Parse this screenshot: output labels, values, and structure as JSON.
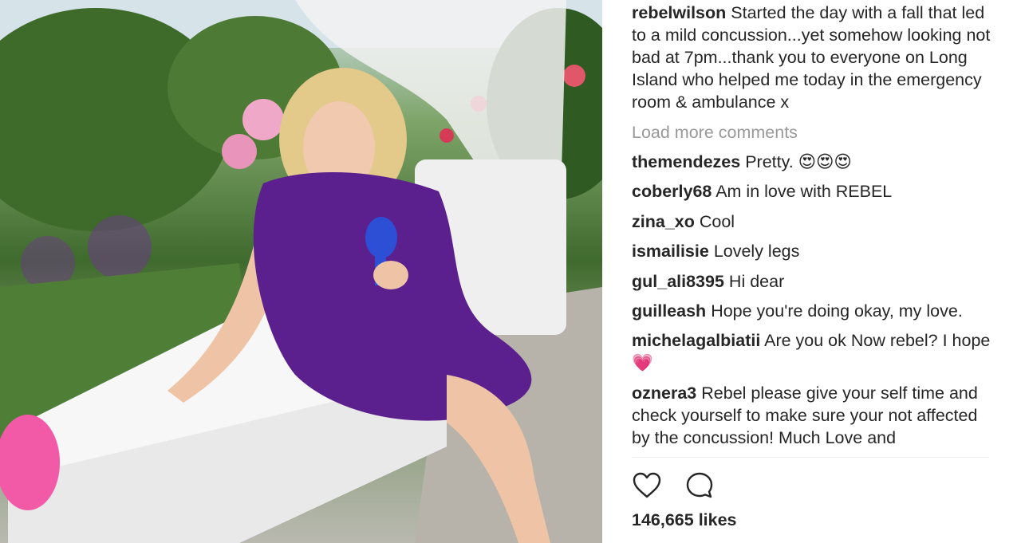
{
  "post": {
    "author": "rebelwilson",
    "caption": "Started the day with a fall that led to a mild concussion...yet somehow looking not bad at 7pm...thank you to everyone on Long Island who helped me today in the emergency room & ambulance x"
  },
  "load_more_label": "Load more comments",
  "comments": [
    {
      "user": "themendezes",
      "text": "Pretty. 😍😍😍"
    },
    {
      "user": "coberly68",
      "text": "Am in love with REBEL"
    },
    {
      "user": "zina_xo",
      "text": "Cool"
    },
    {
      "user": "ismailisie",
      "text": "Lovely legs"
    },
    {
      "user": "gul_ali8395",
      "text": "Hi dear"
    },
    {
      "user": "guilleash",
      "text": "Hope you're doing okay, my love."
    },
    {
      "user": "michelagalbiatii",
      "text": "Are you ok Now rebel? I hope💗"
    },
    {
      "user": "oznera3",
      "text": "Rebel please give your self time and check yourself to make sure your not affected by the concussion! Much Love and"
    }
  ],
  "actions": {
    "like_icon": "heart-outline-icon",
    "comment_icon": "speech-bubble-icon"
  },
  "likes": "146,665 likes",
  "colors": {
    "username": "#262626",
    "muted": "#999999",
    "dress": "#5b1f8e"
  }
}
